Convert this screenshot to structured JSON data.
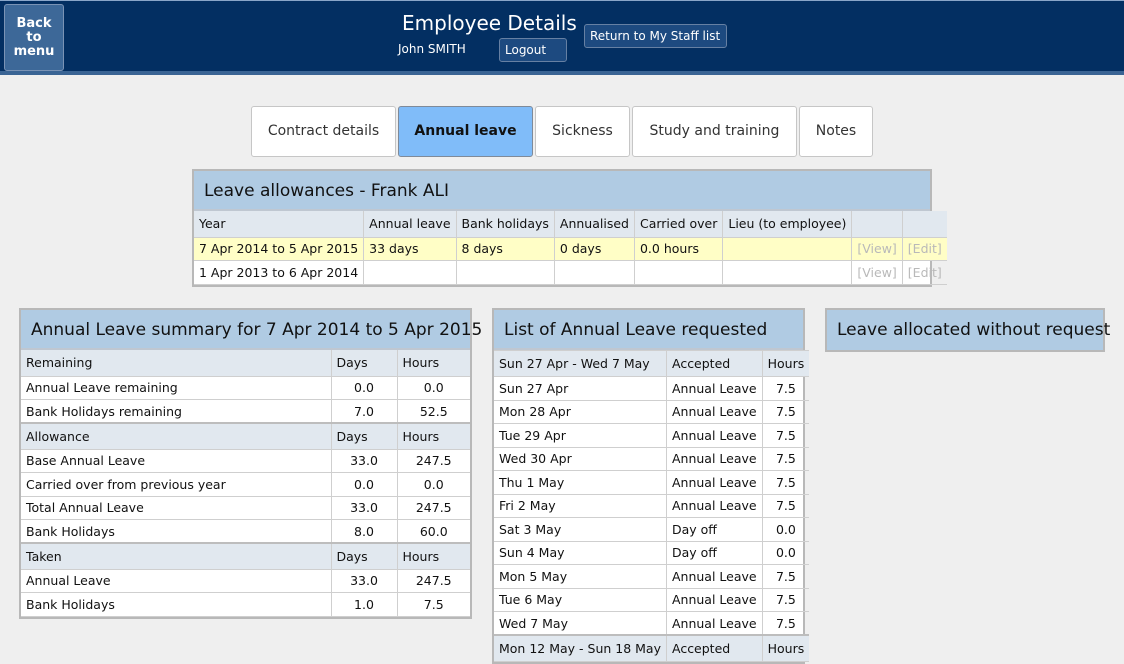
{
  "header": {
    "back_label_lines": [
      "Back",
      "to",
      "menu"
    ],
    "title": "Employee Details",
    "user_name": "John SMITH",
    "logout_label": "Logout",
    "return_label": "Return to My Staff list"
  },
  "tabs": [
    {
      "label": "Contract details",
      "active": false
    },
    {
      "label": "Annual leave",
      "active": true
    },
    {
      "label": "Sickness",
      "active": false
    },
    {
      "label": "Study and training",
      "active": false
    },
    {
      "label": "Notes",
      "active": false
    }
  ],
  "allowances": {
    "title": "Leave allowances - Frank ALI",
    "columns": [
      "Year",
      "Annual leave",
      "Bank holidays",
      "Annualised",
      "Carried over",
      "Lieu (to employee)",
      "",
      ""
    ],
    "rows": [
      {
        "year": "7 Apr 2014 to 5 Apr 2015",
        "annual_leave": "33 days",
        "bank_holidays": "8 days",
        "annualised": "0 days",
        "carried_over": "0.0 hours",
        "lieu": "",
        "view": "[View]",
        "edit": "[Edit]",
        "highlighted": true
      },
      {
        "year": "1 Apr 2013 to 6 Apr 2014",
        "annual_leave": "",
        "bank_holidays": "",
        "annualised": "",
        "carried_over": "",
        "lieu": "",
        "view": "[View]",
        "edit": "[Edit]",
        "highlighted": false
      }
    ]
  },
  "summary": {
    "title": "Annual Leave summary for 7 Apr 2014 to 5 Apr 2015",
    "sections": [
      {
        "heading": "Remaining",
        "days_label": "Days",
        "hours_label": "Hours",
        "rows": [
          {
            "label": "Annual Leave remaining",
            "days": "0.0",
            "hours": "0.0"
          },
          {
            "label": "Bank Holidays remaining",
            "days": "7.0",
            "hours": "52.5"
          }
        ]
      },
      {
        "heading": "Allowance",
        "days_label": "Days",
        "hours_label": "Hours",
        "rows": [
          {
            "label": "Base Annual Leave",
            "days": "33.0",
            "hours": "247.5"
          },
          {
            "label": "Carried over from previous year",
            "days": "0.0",
            "hours": "0.0"
          },
          {
            "label": "Total Annual Leave",
            "days": "33.0",
            "hours": "247.5"
          },
          {
            "label": "Bank Holidays",
            "days": "8.0",
            "hours": "60.0"
          }
        ]
      },
      {
        "heading": "Taken",
        "days_label": "Days",
        "hours_label": "Hours",
        "rows": [
          {
            "label": "Annual Leave",
            "days": "33.0",
            "hours": "247.5"
          },
          {
            "label": "Bank Holidays",
            "days": "1.0",
            "hours": "7.5"
          }
        ]
      }
    ]
  },
  "requested": {
    "title": "List of Annual Leave requested",
    "groups": [
      {
        "range": "Sun 27 Apr - Wed 7 May",
        "status_label": "Accepted",
        "hours_label": "Hours",
        "rows": [
          {
            "date": "Sun 27 Apr",
            "type": "Annual Leave",
            "hours": "7.5"
          },
          {
            "date": "Mon 28 Apr",
            "type": "Annual Leave",
            "hours": "7.5"
          },
          {
            "date": "Tue 29 Apr",
            "type": "Annual Leave",
            "hours": "7.5"
          },
          {
            "date": "Wed 30 Apr",
            "type": "Annual Leave",
            "hours": "7.5"
          },
          {
            "date": "Thu 1 May",
            "type": "Annual Leave",
            "hours": "7.5"
          },
          {
            "date": "Fri 2 May",
            "type": "Annual Leave",
            "hours": "7.5"
          },
          {
            "date": "Sat 3 May",
            "type": "Day off",
            "hours": "0.0"
          },
          {
            "date": "Sun 4 May",
            "type": "Day off",
            "hours": "0.0"
          },
          {
            "date": "Mon 5 May",
            "type": "Annual Leave",
            "hours": "7.5"
          },
          {
            "date": "Tue 6 May",
            "type": "Annual Leave",
            "hours": "7.5"
          },
          {
            "date": "Wed 7 May",
            "type": "Annual Leave",
            "hours": "7.5"
          }
        ]
      },
      {
        "range": "Mon 12 May - Sun 18 May",
        "status_label": "Accepted",
        "hours_label": "Hours",
        "rows": []
      }
    ]
  },
  "unrequested": {
    "title": "Leave allocated without request"
  }
}
